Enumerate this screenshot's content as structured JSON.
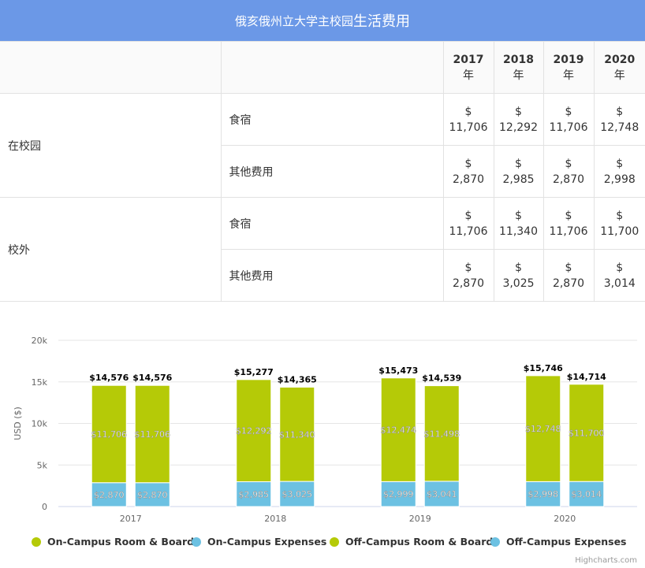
{
  "header": {
    "title_part1": "俄亥俄州立大学主校园",
    "title_part2": "生活费用"
  },
  "table": {
    "years": [
      {
        "year": "2017",
        "unit": "年"
      },
      {
        "year": "2018",
        "unit": "年"
      },
      {
        "year": "2019",
        "unit": "年"
      },
      {
        "year": "2020",
        "unit": "年"
      }
    ],
    "groups": [
      {
        "label": "在校园",
        "rows": [
          {
            "label": "食宿",
            "values": [
              {
                "cur": "$",
                "amt": "11,706"
              },
              {
                "cur": "$",
                "amt": "12,292"
              },
              {
                "cur": "$",
                "amt": "11,706"
              },
              {
                "cur": "$",
                "amt": "12,748"
              }
            ]
          },
          {
            "label": "其他费用",
            "values": [
              {
                "cur": "$",
                "amt": "2,870"
              },
              {
                "cur": "$",
                "amt": "2,985"
              },
              {
                "cur": "$",
                "amt": "2,870"
              },
              {
                "cur": "$",
                "amt": "2,998"
              }
            ]
          }
        ]
      },
      {
        "label": "校外",
        "rows": [
          {
            "label": "食宿",
            "values": [
              {
                "cur": "$",
                "amt": "11,706"
              },
              {
                "cur": "$",
                "amt": "11,340"
              },
              {
                "cur": "$",
                "amt": "11,706"
              },
              {
                "cur": "$",
                "amt": "11,700"
              }
            ]
          },
          {
            "label": "其他费用",
            "values": [
              {
                "cur": "$",
                "amt": "2,870"
              },
              {
                "cur": "$",
                "amt": "3,025"
              },
              {
                "cur": "$",
                "amt": "2,870"
              },
              {
                "cur": "$",
                "amt": "3,014"
              }
            ]
          }
        ]
      }
    ]
  },
  "chart_data": {
    "type": "bar",
    "stacked": true,
    "categories": [
      "2017",
      "2018",
      "2019",
      "2020"
    ],
    "ylabel": "USD ($)",
    "ylim": [
      0,
      20000
    ],
    "yticks": [
      0,
      5000,
      10000,
      15000,
      20000
    ],
    "ytick_labels": [
      "0",
      "5k",
      "10k",
      "15k",
      "20k"
    ],
    "grid": true,
    "legend_position": "bottom",
    "stacks": [
      {
        "name": "on-campus",
        "totals": [
          14576,
          15277,
          15473,
          15746
        ],
        "total_labels": [
          "$14,576",
          "$15,277",
          "$15,473",
          "$15,746"
        ]
      },
      {
        "name": "off-campus",
        "totals": [
          14576,
          14365,
          14539,
          14714
        ],
        "total_labels": [
          "$14,576",
          "$14,365",
          "$14,539",
          "$14,714"
        ]
      }
    ],
    "series": [
      {
        "name": "On-Campus Room & Board",
        "stack": "on-campus",
        "color": "#b5ca07",
        "values": [
          11706,
          12292,
          12474,
          12748
        ],
        "labels": [
          "$11,706",
          "$12,292",
          "$12,474",
          "$12,748"
        ]
      },
      {
        "name": "On-Campus Expenses",
        "stack": "on-campus",
        "color": "#6cc1e2",
        "values": [
          2870,
          2985,
          2999,
          2998
        ],
        "labels": [
          "$2,870",
          "$2,985",
          "$2,999",
          "$2,998"
        ]
      },
      {
        "name": "Off-Campus Room & Board",
        "stack": "off-campus",
        "color": "#b5ca07",
        "values": [
          11706,
          11340,
          11498,
          11700
        ],
        "labels": [
          "$11,706",
          "$11,340",
          "$11,498",
          "$11,700"
        ]
      },
      {
        "name": "Off-Campus Expenses",
        "stack": "off-campus",
        "color": "#6cc1e2",
        "values": [
          2870,
          3025,
          3041,
          3014
        ],
        "labels": [
          "$2,870",
          "$3,025",
          "$3,041",
          "$3,014"
        ]
      }
    ]
  },
  "credits": "Highcharts.com"
}
